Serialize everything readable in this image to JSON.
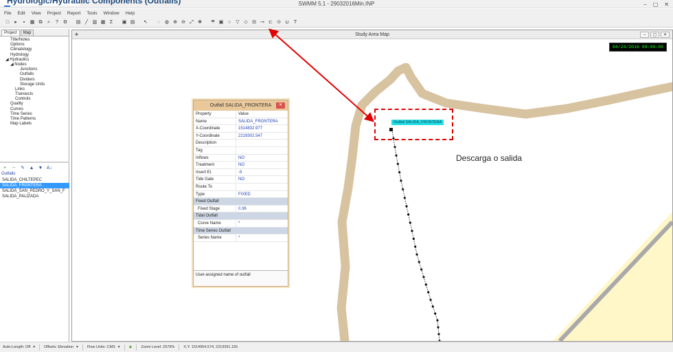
{
  "window": {
    "title": "SWMM 5.1 - 29032016Min.INP",
    "controls": [
      "‒",
      "▢",
      "✕"
    ]
  },
  "overlay": {
    "text": "Hydrologic/Hydraulic Components (Outfalls)"
  },
  "menu": [
    "File",
    "Edit",
    "View",
    "Project",
    "Report",
    "Tools",
    "Window",
    "Help"
  ],
  "toolbar_icons": [
    "new-file-icon",
    "open-file-icon",
    "save-icon",
    "print-icon",
    "copy-icon",
    "find-icon",
    "query-icon",
    "run-icon",
    "sep",
    "report-icon",
    "profile-icon",
    "graph-icon",
    "table-icon",
    "statistics-icon",
    "sep",
    "options-icon",
    "arrange-icon",
    "sep",
    "select-icon",
    "sep",
    "vertex-icon",
    "region-icon",
    "zoom-in-icon",
    "zoom-out-icon",
    "full-extent-icon",
    "pan-icon",
    "sep",
    "raingage-icon",
    "subcatchment-icon",
    "junction-icon",
    "outfall-icon",
    "divider-icon",
    "storage-icon",
    "conduit-icon",
    "pump-icon",
    "orifice-icon",
    "weir-icon",
    "label-icon"
  ],
  "toolbar_glyphs": [
    "□",
    "▸",
    "▪",
    "▦",
    "⧉",
    "⌕",
    "?",
    "⚙",
    "",
    "▤",
    "╱",
    "▥",
    "▦",
    "Σ",
    "",
    "▣",
    "▤",
    "",
    "↖",
    "",
    "◌",
    "◍",
    "⊕",
    "⊖",
    "⤢",
    "✥",
    "",
    "☂",
    "▣",
    "○",
    "▽",
    "◇",
    "⊟",
    "⊸",
    "⊏",
    "⊙",
    "⊔",
    "T"
  ],
  "left": {
    "tabs": [
      "Project",
      "Map"
    ],
    "tree": [
      {
        "label": "Title/Notes",
        "indent": 1
      },
      {
        "label": "Options",
        "indent": 1
      },
      {
        "label": "Climatology",
        "indent": 1
      },
      {
        "label": "Hydrology",
        "indent": 1
      },
      {
        "label": "◢ Hydraulics",
        "indent": 0
      },
      {
        "label": "◢ Nodes",
        "indent": 1
      },
      {
        "label": "Junctions",
        "indent": 3
      },
      {
        "label": "Outfalls",
        "indent": 3
      },
      {
        "label": "Dividers",
        "indent": 3
      },
      {
        "label": "Storage Units",
        "indent": 3
      },
      {
        "label": "Links",
        "indent": 2
      },
      {
        "label": "Transects",
        "indent": 2
      },
      {
        "label": "Controls",
        "indent": 2
      },
      {
        "label": "Quality",
        "indent": 1
      },
      {
        "label": "Curves",
        "indent": 1
      },
      {
        "label": "Time Series",
        "indent": 1
      },
      {
        "label": "Time Patterns",
        "indent": 1
      },
      {
        "label": "Map Labels",
        "indent": 1
      }
    ],
    "object_buttons": [
      "+",
      "−",
      "✎",
      "▲",
      "▼",
      "A↓"
    ],
    "object_heading": "Outfalls",
    "objects": [
      "SALIDA_CHILTEPEC",
      "SALIDA_FRONTERA",
      "SALIDA_SAN_PEDRO_Y_SAN_F",
      "SALIDA_PALIZADA"
    ],
    "selected_index": 1
  },
  "map": {
    "title": "Study Area Map",
    "datetime": "04/24/2016 09:00:00",
    "node_label": "Outfall SALIDA_FRONTERA",
    "win_buttons": [
      "–",
      "▢",
      "✕"
    ]
  },
  "dialog": {
    "title": "Outfall SALIDA_FRONTERA",
    "close": "✕",
    "rows": [
      {
        "p": "Property",
        "v": "Value",
        "k": "hdr"
      },
      {
        "p": "Name",
        "v": "SALIDA_FRONTERA"
      },
      {
        "p": "X-Coordinate",
        "v": "1514832.977"
      },
      {
        "p": "Y-Coordinate",
        "v": "2219302.547"
      },
      {
        "p": "Description",
        "v": ""
      },
      {
        "p": "Tag",
        "v": ""
      },
      {
        "p": "Inflows",
        "v": "NO"
      },
      {
        "p": "Treatment",
        "v": "NO"
      },
      {
        "p": "Invert El.",
        "v": "-5"
      },
      {
        "p": "Tide Gate",
        "v": "NO"
      },
      {
        "p": "Route To",
        "v": ""
      },
      {
        "p": "Type",
        "v": "FIXED"
      },
      {
        "p": "Fixed Outfall",
        "v": "",
        "k": "section"
      },
      {
        "p": "Fixed Stage",
        "v": "0.36",
        "k": "sub"
      },
      {
        "p": "Tidal Outfall",
        "v": "",
        "k": "section"
      },
      {
        "p": "Curve Name",
        "v": "*",
        "k": "sub"
      },
      {
        "p": "Time Series Outfall",
        "v": "",
        "k": "section"
      },
      {
        "p": "Series Name",
        "v": "*",
        "k": "sub"
      }
    ],
    "hint": "User-assigned name of outfall"
  },
  "annotation": {
    "text": "Descarga o salida",
    "color": "#e00000"
  },
  "status": {
    "auto_length": "Auto-Length: Off",
    "offsets": "Offsets: Elevation",
    "flow_units": "Flow Units: CMS",
    "zoom": "Zoom Level: 2579%",
    "xy": "X,Y: 1514954.574, 2219391.155"
  },
  "colors": {
    "river": "#d8c3a0",
    "land": "#fff7c8",
    "road": "#a9a9a9",
    "clock_bg": "#000000",
    "clock_text": "#22ff22",
    "node_label_bg": "#23e0e5"
  }
}
